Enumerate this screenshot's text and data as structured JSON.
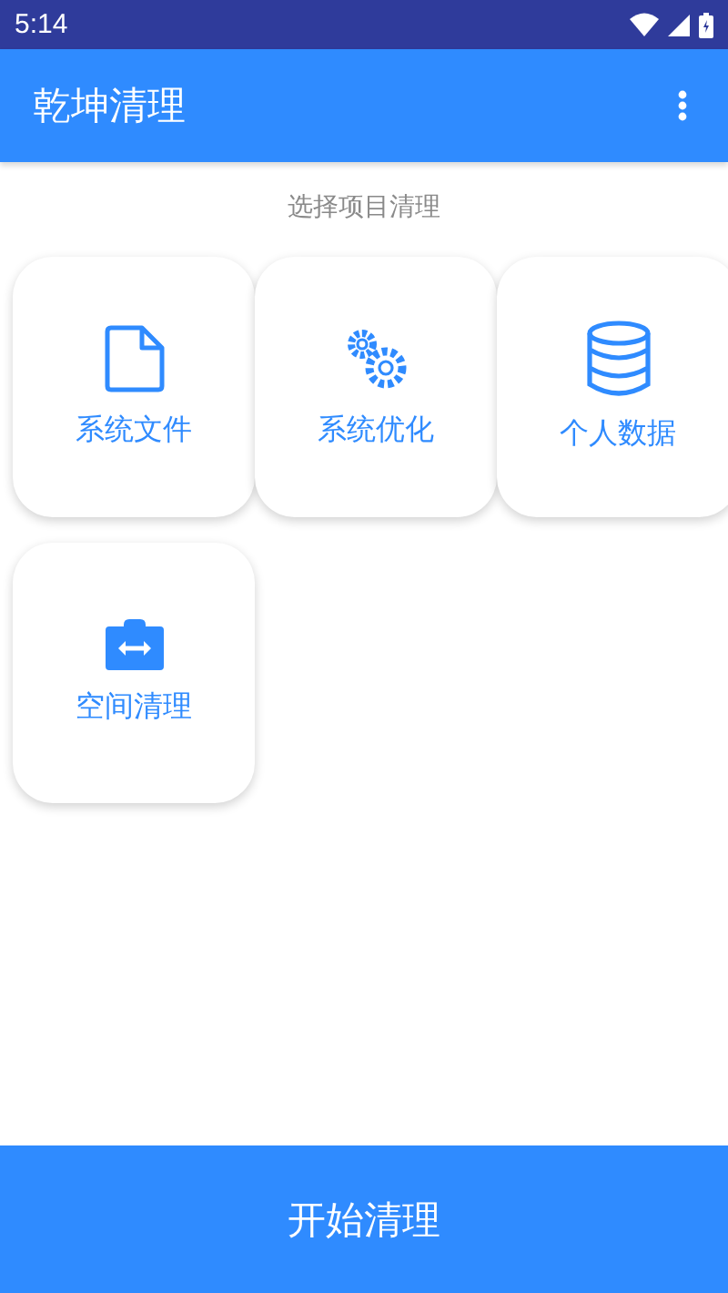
{
  "status_bar": {
    "time": "5:14"
  },
  "app_bar": {
    "title": "乾坤清理"
  },
  "subtitle": "选择项目清理",
  "items": [
    {
      "label": "系统文件",
      "kind": "file"
    },
    {
      "label": "系统优化",
      "kind": "gears"
    },
    {
      "label": "个人数据",
      "kind": "database"
    },
    {
      "label": "空间清理",
      "kind": "case"
    }
  ],
  "start_button": "开始清理"
}
